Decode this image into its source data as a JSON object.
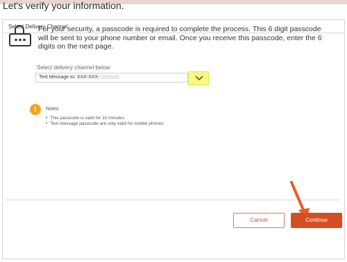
{
  "page": {
    "title": "Let's verify your information."
  },
  "card": {
    "header": "Select Delivery Channel",
    "security_text": "For your security, a passcode is required to complete the process. This 6 digit passcode will be sent to your phone number or email. Once you receive this passcode, enter the 6 digits on the next page.",
    "select_label": "Select delivery channel below",
    "select_value": "Text Message to: XXX-XXX-",
    "notes_title": "Notes",
    "notes": [
      "This passcode is valid for 10 minutes.",
      "Text message passcode are only valid for mobile phones"
    ]
  },
  "buttons": {
    "cancel": "Cancel",
    "continue": "Continue"
  },
  "icons": {
    "lock": "lock-password-icon",
    "warning": "exclamation-warning-icon",
    "dropdown": "chevron-down-icon",
    "annotation": "orange-arrow-icon"
  },
  "colors": {
    "accent": "#d34f21",
    "warning": "#f3a21c",
    "highlight": "#fbfa7f"
  }
}
